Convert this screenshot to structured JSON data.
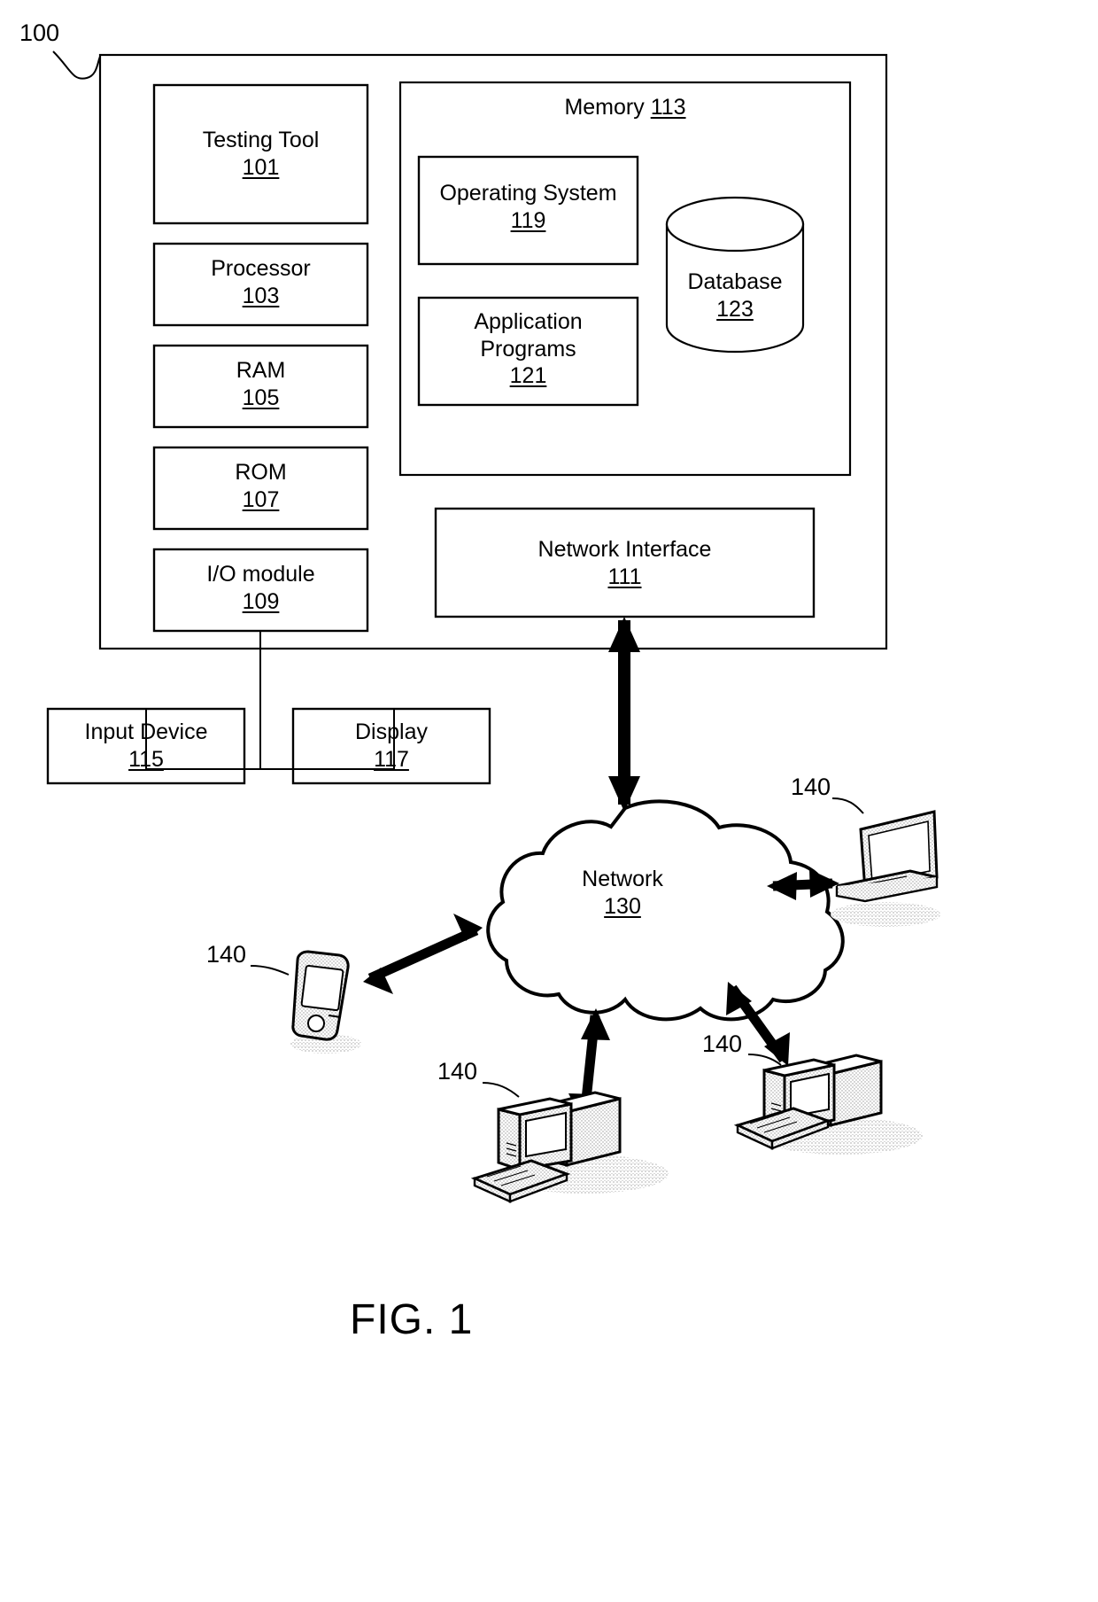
{
  "figure": {
    "caption": "FIG. 1",
    "system_ref": "100"
  },
  "computing_device": {
    "ref": "100",
    "left_column_blocks": [
      {
        "label": "Testing Tool",
        "ref": "101"
      },
      {
        "label": "Processor",
        "ref": "103"
      },
      {
        "label": "RAM",
        "ref": "105"
      },
      {
        "label": "ROM",
        "ref": "107"
      },
      {
        "label": "I/O module",
        "ref": "109"
      }
    ],
    "memory": {
      "label": "Memory",
      "ref": "113",
      "blocks": [
        {
          "label": "Operating System",
          "ref": "119"
        },
        {
          "label": "Application Programs",
          "label_line1": "Application",
          "label_line2": "Programs",
          "ref": "121"
        }
      ],
      "database": {
        "label": "Database",
        "ref": "123"
      }
    },
    "network_interface": {
      "label": "Network Interface",
      "ref": "111"
    }
  },
  "peripherals": [
    {
      "label": "Input Device",
      "ref": "115"
    },
    {
      "label": "Display",
      "ref": "117"
    }
  ],
  "network": {
    "label": "Network",
    "ref": "130"
  },
  "terminals": [
    {
      "name": "laptop",
      "ref": "140"
    },
    {
      "name": "mobile-device",
      "ref": "140"
    },
    {
      "name": "desktop-computer-center",
      "ref": "140"
    },
    {
      "name": "desktop-computer-right",
      "ref": "140"
    }
  ]
}
